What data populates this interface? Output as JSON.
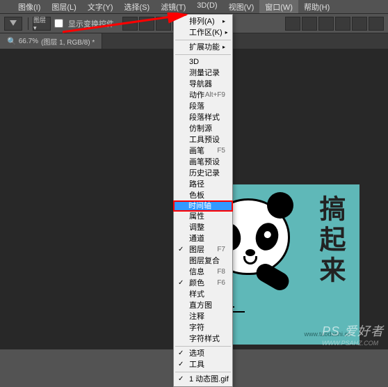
{
  "menubar": {
    "items": [
      "图像(I)",
      "图层(L)",
      "文字(Y)",
      "选择(S)",
      "滤镜(T)",
      "3D(D)",
      "视图(V)",
      "窗口(W)",
      "帮助(H)"
    ],
    "active_index": 7
  },
  "toolbar": {
    "checkbox_label": "显示变换控件"
  },
  "tab": {
    "percent": "66.7%",
    "doc_info": "(图层 1, RGB/8) *"
  },
  "window_menu": {
    "groups": [
      [
        {
          "label": "排列(A)",
          "sub": true
        },
        {
          "label": "工作区(K)",
          "sub": true
        }
      ],
      [
        {
          "label": "扩展功能",
          "sub": true
        }
      ],
      [
        {
          "label": "3D"
        },
        {
          "label": "测量记录"
        },
        {
          "label": "导航器"
        },
        {
          "label": "动作",
          "shortcut": "Alt+F9"
        },
        {
          "label": "段落"
        },
        {
          "label": "段落样式"
        },
        {
          "label": "仿制源"
        },
        {
          "label": "工具预设"
        },
        {
          "label": "画笔",
          "shortcut": "F5"
        },
        {
          "label": "画笔预设"
        },
        {
          "label": "历史记录"
        },
        {
          "label": "路径"
        },
        {
          "label": "色板"
        },
        {
          "label": "时间轴",
          "selected": true
        },
        {
          "label": "属性"
        },
        {
          "label": "调整"
        },
        {
          "label": "通道"
        },
        {
          "label": "图层",
          "shortcut": "F7",
          "checked": true
        },
        {
          "label": "图层复合"
        },
        {
          "label": "信息",
          "shortcut": "F8"
        },
        {
          "label": "颜色",
          "shortcut": "F6",
          "checked": true
        },
        {
          "label": "样式"
        },
        {
          "label": "直方图"
        },
        {
          "label": "注释"
        },
        {
          "label": "字符"
        },
        {
          "label": "字符样式"
        }
      ],
      [
        {
          "label": "选项",
          "checked": true
        },
        {
          "label": "工具",
          "checked": true
        }
      ],
      [
        {
          "label": "1 动态图.gif",
          "checked": true
        }
      ]
    ]
  },
  "canvas": {
    "big_text": "搞起来",
    "url": "www.taodashi.cn"
  },
  "watermark": {
    "main": "PS 爱好者",
    "sub": "WWW.PSAHZ.COM"
  }
}
